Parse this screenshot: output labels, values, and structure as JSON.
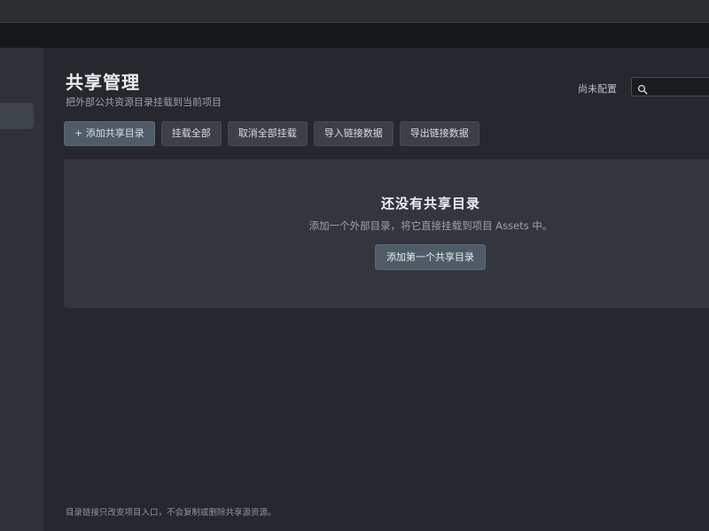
{
  "header": {
    "title": "共享管理",
    "subtitle": "把外部公共资源目录挂载到当前项目",
    "status": "尚未配置"
  },
  "search": {
    "placeholder": "",
    "value": ""
  },
  "toolbar": {
    "add_label": "+ 添加共享目录",
    "mount_all_label": "挂载全部",
    "unmount_all_label": "取消全部挂载",
    "import_label": "导入链接数据",
    "export_label": "导出链接数据"
  },
  "empty_state": {
    "title": "还没有共享目录",
    "description": "添加一个外部目录，将它直接挂载到项目 Assets 中。",
    "action_label": "添加第一个共享目录"
  },
  "footer": {
    "note": "目录链接只改变项目入口，不会复制或删除共享源资源。"
  },
  "icons": {
    "search": "search-icon"
  }
}
